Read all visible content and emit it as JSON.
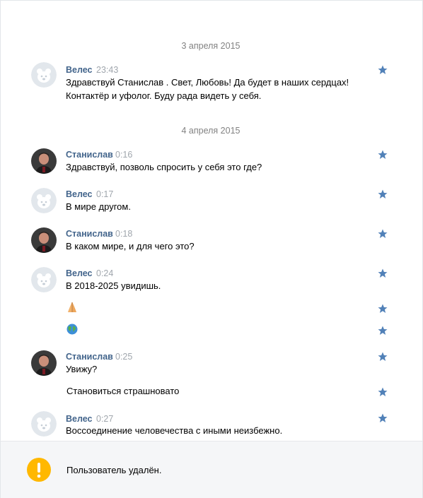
{
  "dates": [
    "3 апреля 2015",
    "4 апреля 2015"
  ],
  "messages": [
    {
      "author": "Велес",
      "time": "23:43",
      "lines": [
        "Здравствуй Станислав . Свет, Любовь! Да будет в наших сердцах!",
        "Контактёр и уфолог. Буду рада видеть у себя."
      ]
    },
    {
      "author": "Станислав",
      "time": "0:16",
      "lines": [
        "Здравствуй, позволь спросить у себя это где?"
      ]
    },
    {
      "author": "Велес",
      "time": "0:17",
      "lines": [
        "В мире другом."
      ]
    },
    {
      "author": "Станислав",
      "time": "0:18",
      "lines": [
        "В каком мире, и для чего это?"
      ]
    },
    {
      "author": "Велес",
      "time": "0:24",
      "lines": [
        "В 2018-2025 увидишь."
      ],
      "extras": [
        "praying-hands-emoji",
        "globe-emoji"
      ]
    },
    {
      "author": "Станислав",
      "time": "0:25",
      "lines": [
        "Увижу?"
      ],
      "extra_text": "Становиться страшновато"
    },
    {
      "author": "Велес",
      "time": "0:27",
      "lines": [
        "Воссоединение человечества с иными неизбежно."
      ]
    }
  ],
  "footer": {
    "text": "Пользователь удалён.",
    "icon": "warning-icon"
  },
  "colors": {
    "name": "#42648b",
    "star": "#5181b8",
    "warning": "#ffb800"
  }
}
